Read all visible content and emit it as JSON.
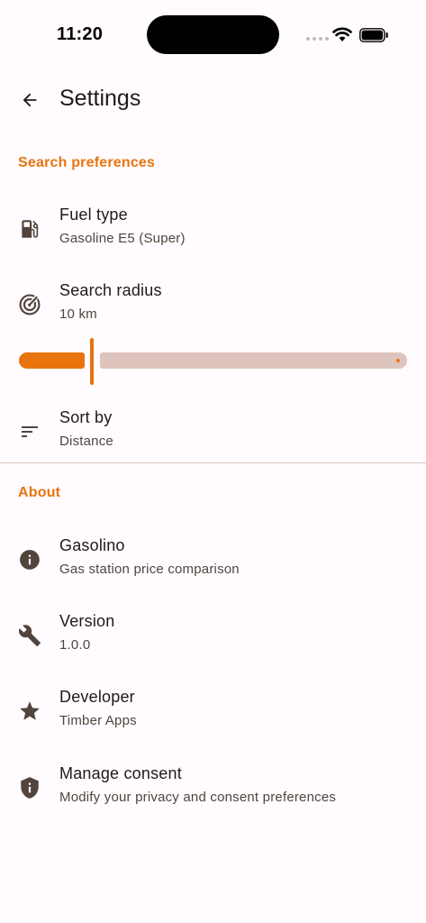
{
  "status_bar": {
    "time": "11:20"
  },
  "app_bar": {
    "title": "Settings",
    "back_icon": "arrow-back-icon"
  },
  "sections": {
    "search": {
      "header": "Search preferences",
      "fuel_type": {
        "title": "Fuel type",
        "summary": "Gasoline E5 (Super)",
        "icon": "fuel-pump-icon"
      },
      "search_radius": {
        "title": "Search radius",
        "summary": "10 km",
        "icon": "radar-icon",
        "slider_fraction": 0.19
      },
      "sort_by": {
        "title": "Sort by",
        "summary": "Distance",
        "icon": "sort-icon"
      }
    },
    "about": {
      "header": "About",
      "app": {
        "title": "Gasolino",
        "summary": "Gas station price comparison",
        "icon": "info-icon"
      },
      "version": {
        "title": "Version",
        "summary": "1.0.0",
        "icon": "wrench-icon"
      },
      "developer": {
        "title": "Developer",
        "summary": "Timber Apps",
        "icon": "star-icon"
      },
      "consent": {
        "title": "Manage consent",
        "summary": "Modify your privacy and consent preferences",
        "icon": "shield-icon"
      }
    }
  },
  "colors": {
    "accent": "#E8740E",
    "track_inactive": "#DDC5BD",
    "icon": "#52443D",
    "background": "#FFFBFE"
  }
}
